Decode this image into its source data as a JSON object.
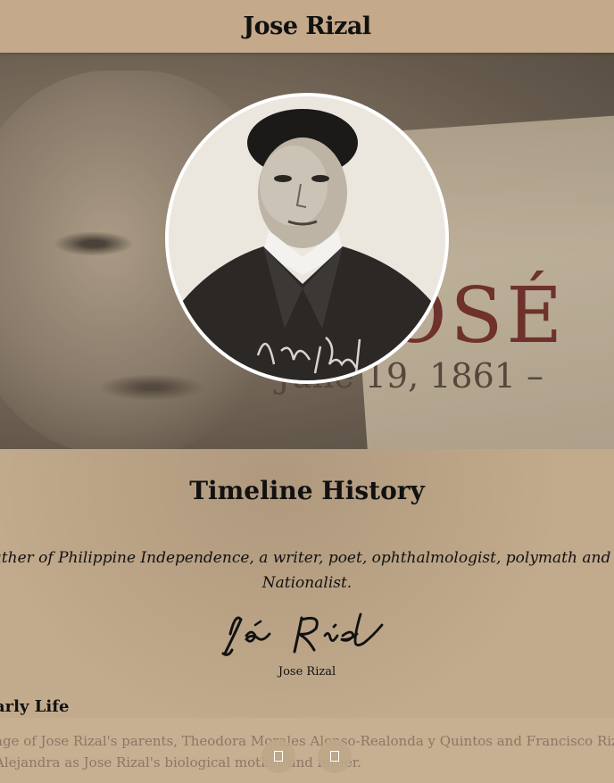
{
  "header": {
    "title": "Jose Rizal"
  },
  "hero": {
    "poster_name": "OSÉ",
    "poster_date": "June 19, 1861 –"
  },
  "timeline": {
    "title": "Timeline History",
    "quote_line1": "Father of Philippine Independence, a writer, poet, ophthalmologist, polymath and Fi",
    "quote_line2": "Nationalist.",
    "signature_caption": "Jose Rizal"
  },
  "section": {
    "title": "Early Life",
    "display_title": "arly Life",
    "paragraph_line1": "age of Jose Rizal's parents, Theodora Morales Alonso-Realonda y Quintos and Francisco Rizal",
    "paragraph_line2": "Alejandra as Jose Rizal's biological mother and father."
  },
  "nav": {
    "prev_icon": "prev-icon",
    "next_icon": "next-icon"
  },
  "colors": {
    "background": "#c2aa8c",
    "header": "#c4a98a",
    "text": "#111111",
    "muted_text": "#8a7765"
  }
}
